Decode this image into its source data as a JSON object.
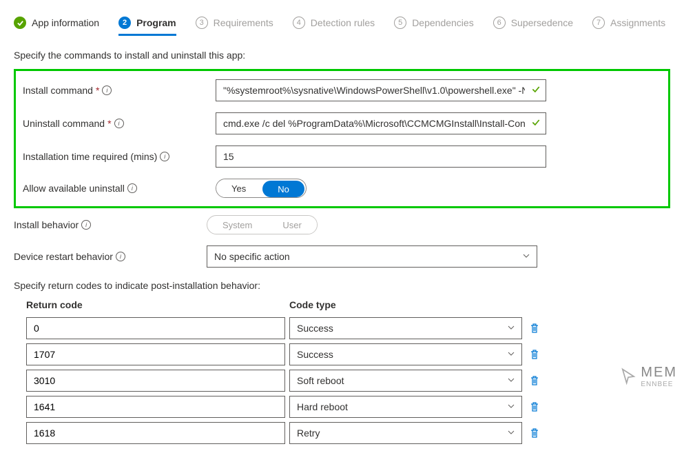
{
  "tabs": [
    {
      "label": "App information",
      "state": "completed"
    },
    {
      "label": "Program",
      "state": "active",
      "num": "2"
    },
    {
      "label": "Requirements",
      "state": "disabled",
      "num": "3"
    },
    {
      "label": "Detection rules",
      "state": "disabled",
      "num": "4"
    },
    {
      "label": "Dependencies",
      "state": "disabled",
      "num": "5"
    },
    {
      "label": "Supersedence",
      "state": "disabled",
      "num": "6"
    },
    {
      "label": "Assignments",
      "state": "disabled",
      "num": "7"
    }
  ],
  "section1_text": "Specify the commands to install and uninstall this app:",
  "fields": {
    "install_cmd": {
      "label": "Install command",
      "required": true,
      "value": "\"%systemroot%\\sysnative\\WindowsPowerShell\\v1.0\\powershell.exe\" -NoProfile…",
      "validated": true
    },
    "uninstall_cmd": {
      "label": "Uninstall command",
      "required": true,
      "value": "cmd.exe /c del %ProgramData%\\Microsoft\\CCMCMGInstall\\Install-ConfigMgrC…",
      "validated": true
    },
    "install_time": {
      "label": "Installation time required (mins)",
      "required": false,
      "value": "15"
    },
    "allow_uninstall": {
      "label": "Allow available uninstall",
      "options": [
        "Yes",
        "No"
      ],
      "selected": "No"
    },
    "install_behavior": {
      "label": "Install behavior",
      "options": [
        "System",
        "User"
      ],
      "selected": "System",
      "disabled": true
    },
    "restart_behavior": {
      "label": "Device restart behavior",
      "value": "No specific action"
    }
  },
  "section2_text": "Specify return codes to indicate post-installation behavior:",
  "return_codes": {
    "header_code": "Return code",
    "header_type": "Code type",
    "rows": [
      {
        "code": "0",
        "type": "Success"
      },
      {
        "code": "1707",
        "type": "Success"
      },
      {
        "code": "3010",
        "type": "Soft reboot"
      },
      {
        "code": "1641",
        "type": "Hard reboot"
      },
      {
        "code": "1618",
        "type": "Retry"
      }
    ]
  },
  "watermark": {
    "line1": "MEM",
    "line2": "ENNBEE"
  },
  "asterisk": "*"
}
